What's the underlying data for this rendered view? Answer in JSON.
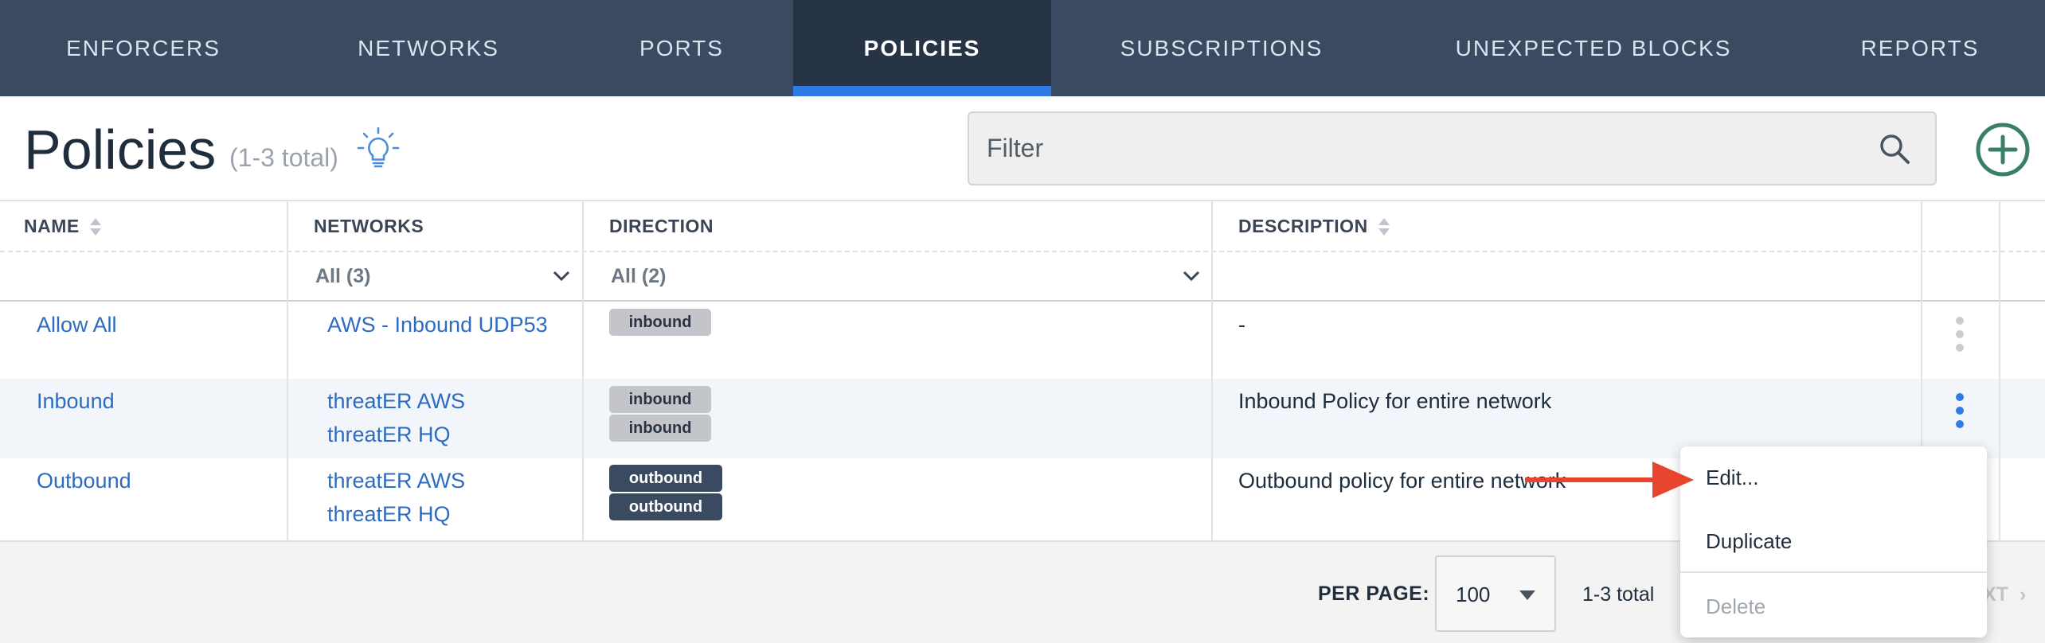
{
  "nav": {
    "tabs": [
      {
        "label": "ENFORCERS"
      },
      {
        "label": "NETWORKS"
      },
      {
        "label": "PORTS"
      },
      {
        "label": "POLICIES",
        "active": true
      },
      {
        "label": "SUBSCRIPTIONS"
      },
      {
        "label": "UNEXPECTED BLOCKS"
      },
      {
        "label": "REPORTS"
      }
    ]
  },
  "header": {
    "title": "Policies",
    "count": "(1-3 total)",
    "hint_icon": "lightbulb-icon",
    "add_icon": "plus-circle-icon"
  },
  "filter": {
    "placeholder": "Filter",
    "icon": "search-icon"
  },
  "table": {
    "columns": [
      {
        "label": "NAME",
        "sortable": true
      },
      {
        "label": "NETWORKS",
        "sortable": false
      },
      {
        "label": "DIRECTION",
        "sortable": false
      },
      {
        "label": "DESCRIPTION",
        "sortable": true
      }
    ],
    "filters": {
      "networks": "All (3)",
      "direction": "All (2)"
    },
    "rows": [
      {
        "name": "Allow All",
        "networks": [
          "AWS - Inbound UDP53"
        ],
        "direction": [
          "inbound"
        ],
        "description": "-"
      },
      {
        "name": "Inbound",
        "networks": [
          "threatER AWS",
          "threatER HQ"
        ],
        "direction": [
          "inbound",
          "inbound"
        ],
        "description": "Inbound Policy for entire network"
      },
      {
        "name": "Outbound",
        "networks": [
          "threatER AWS",
          "threatER HQ"
        ],
        "direction": [
          "outbound",
          "outbound"
        ],
        "description": "Outbound policy for entire network"
      }
    ]
  },
  "context_menu": {
    "edit": "Edit...",
    "duplicate": "Duplicate",
    "delete": "Delete"
  },
  "footer": {
    "per_page_label": "PER PAGE:",
    "per_page_value": "100",
    "total": "1-3 total",
    "next": "XT"
  },
  "colors": {
    "nav_bg": "#394a61",
    "nav_active": "#263445",
    "accent": "#2f7ae5",
    "link": "#2d6cc0",
    "add_button": "#3a8068",
    "annotation_arrow": "#e8452f"
  }
}
